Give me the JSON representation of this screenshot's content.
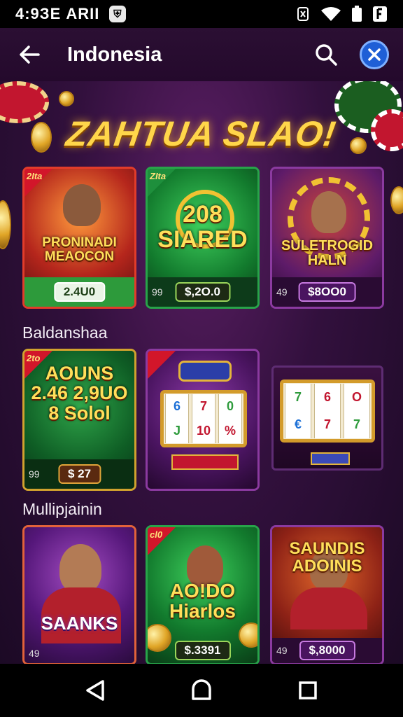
{
  "status_bar": {
    "time": "4:9ЗЕ ARII",
    "left_icon": "shield-icon",
    "right_icons": [
      "nfc-icon",
      "wifi-icon",
      "battery-icon",
      "signal-icon"
    ]
  },
  "app_bar": {
    "title": "Indonesia",
    "back_icon": "arrow-left-icon",
    "search_icon": "search-icon",
    "close_icon": "close-icon"
  },
  "banner": {
    "title": "ZAHTUA SLAO!"
  },
  "sections": [
    {
      "label": ""
    },
    {
      "label": "Baldanshaa"
    },
    {
      "label": "Mullipjainin"
    }
  ],
  "rows": [
    [
      {
        "tag": "2Ita",
        "name": "PRONINADI MEAOCON",
        "number": "",
        "price": "2.4U0",
        "accent": "#2e9b3c"
      },
      {
        "tag": "ZIta",
        "name": "208 SIARED",
        "number": "99",
        "price": "$,2O.0",
        "accent": "#2e9b3c"
      },
      {
        "tag": "",
        "name": "SULETROGID HALN",
        "number": "49",
        "price": "$8ОО0",
        "accent": "#9b3fd0"
      }
    ],
    [
      {
        "tag": "2to",
        "name": "AOUNS 2.46 2,9UO 8 Solol",
        "number": "99",
        "price": "$ 27",
        "accent": "#c28a2a"
      },
      {
        "tag": "",
        "name": "",
        "number": "",
        "price": "",
        "accent": "#7d3b86"
      },
      {
        "tag": "",
        "name": "",
        "number": "",
        "price": "",
        "accent": "#7d3b86"
      }
    ],
    [
      {
        "tag": "",
        "name": "SAANKS",
        "number": "49",
        "price": "",
        "accent": "#c23e3e"
      },
      {
        "tag": "cl0",
        "name": "AO!DO Hiarlos",
        "number": "",
        "price": "$.3391",
        "accent": "#2e9b3c"
      },
      {
        "tag": "",
        "name": "SAUNDIS ADOINIS",
        "number": "49",
        "price": "$,8000",
        "accent": "#9b3fd0"
      }
    ]
  ],
  "nav_bar": {
    "back": "triangle-back-icon",
    "home": "home-icon",
    "recents": "square-recents-icon"
  }
}
